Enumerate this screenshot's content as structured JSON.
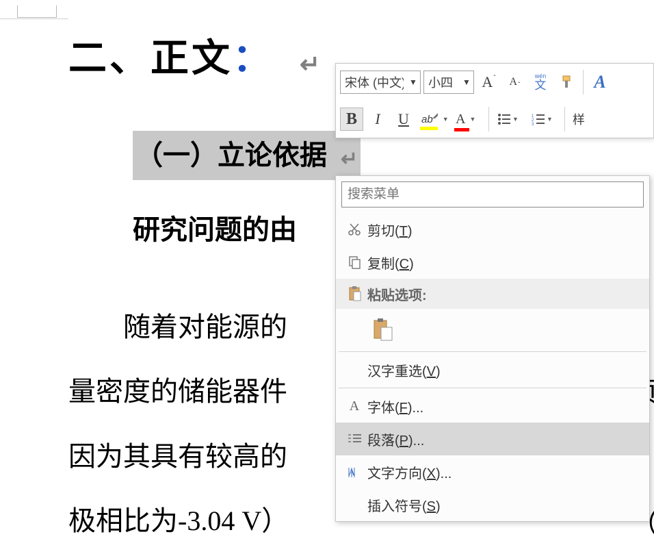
{
  "doc": {
    "heading": "二、正文",
    "heading_colon": "：",
    "sub1": "（一）立论依据",
    "sub2": "研究问题的由",
    "line1": "随着对能源的",
    "line2": "量密度的储能器件",
    "line3": "因为其具有较高的",
    "line4": "极相比为-3.04 V）",
    "frag_right_1": "页",
    "frag_right_2": "（"
  },
  "minitoolbar": {
    "font_name": "宋体 (中文)",
    "font_size": "小四",
    "grow_font_glyph": "A",
    "shrink_font_glyph": "A",
    "phonetic_top": "wén",
    "phonetic_bottom": "文",
    "bold": "B",
    "italic": "I",
    "underline": "U",
    "highlight": "ab",
    "styles_label": "样"
  },
  "context_menu": {
    "search_placeholder": "搜索菜单",
    "cut": "剪切",
    "cut_key": "T",
    "copy": "复制",
    "copy_key": "C",
    "paste_options": "粘贴选项:",
    "reconvert": "汉字重选",
    "reconvert_key": "V",
    "font": "字体",
    "font_key": "F",
    "paragraph": "段落",
    "paragraph_key": "P",
    "text_direction": "文字方向",
    "text_direction_key": "X",
    "insert_symbol": "插入符号",
    "insert_symbol_key": "S"
  }
}
